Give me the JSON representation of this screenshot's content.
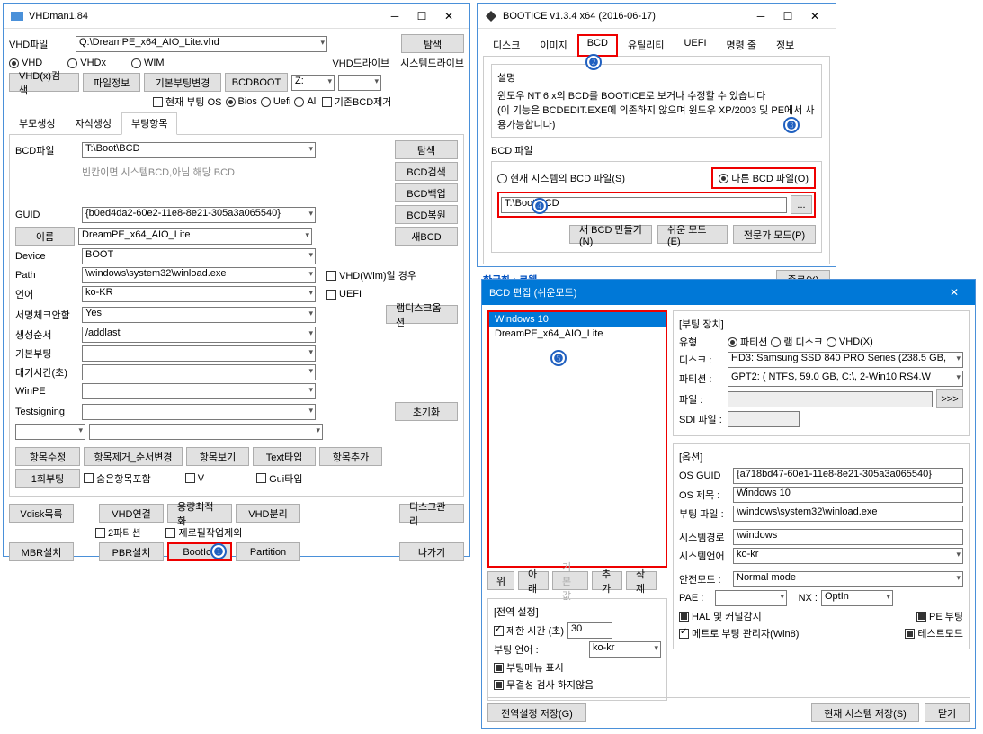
{
  "vhdman": {
    "title": "VHDman1.84",
    "vhdfile_label": "VHD파일",
    "vhdfile_value": "Q:\\DreamPE_x64_AIO_Lite.vhd",
    "browse": "탐색",
    "radio_vhd": "VHD",
    "radio_vhdx": "VHDx",
    "radio_wim": "WIM",
    "vhd_drive": "VHD드라이브",
    "sys_drive": "시스템드라이브",
    "btn_vhdx_search": "VHD(x)검색",
    "btn_fileinfo": "파일정보",
    "btn_basicboot": "기본부팅변경",
    "btn_bcdboot": "BCDBOOT",
    "drive_z": "Z:",
    "chk_current_boot": "현재 부팅 OS",
    "radio_bios": "Bios",
    "radio_uefi": "Uefi",
    "radio_all": "All",
    "chk_remove_bcd": "기존BCD제거",
    "tab_parent": "부모생성",
    "tab_child": "자식생성",
    "tab_boot": "부팅항목",
    "bcdfile_label": "BCD파일",
    "bcdfile_value": "T:\\Boot\\BCD",
    "bcdfile_hint": "빈칸이면 시스템BCD,아님 해당 BCD",
    "btn_search2": "탐색",
    "btn_bcd_search": "BCD검색",
    "btn_bcd_backup": "BCD백업",
    "btn_bcd_restore": "BCD복원",
    "btn_new_bcd": "새BCD",
    "guid_label": "GUID",
    "guid_value": "{b0ed4da2-60e2-11e8-8e21-305a3a065540}",
    "name_label": "이름",
    "name_value": "DreamPE_x64_AIO_Lite",
    "device_label": "Device",
    "device_value": "BOOT",
    "path_label": "Path",
    "path_value": "\\windows\\system32\\winload.exe",
    "lang_label": "언어",
    "lang_value": "ko-KR",
    "sign_label": "서명체크안함",
    "sign_value": "Yes",
    "order_label": "생성순서",
    "order_value": "/addlast",
    "default_boot": "기본부팅",
    "wait_time": "대기시간(초)",
    "winpe": "WinPE",
    "testsigning": "Testsigning",
    "chk_vhdwim": "VHD(Wim)일 경우",
    "chk_uefi": "UEFI",
    "btn_ramdisk": "램디스크옵션",
    "btn_init": "초기화",
    "btn_edit": "항목수정",
    "btn_remove": "항목제거_순서변경",
    "btn_view": "항목보기",
    "btn_texttype": "Text타입",
    "btn_add": "항목추가",
    "btn_oneboot": "1회부팅",
    "chk_hidden": "숨은항목포함",
    "chk_v": "V",
    "chk_guitype": "Gui타입",
    "btn_vdisk": "Vdisk목록",
    "btn_vhdconnect": "VHD연결",
    "btn_optimize": "용량최적화",
    "btn_vhdsplit": "VHD분리",
    "btn_diskmgr": "디스크관리",
    "chk_2part": "2파티션",
    "chk_zerofill": "제로필작업제외",
    "btn_mbr": "MBR설치",
    "btn_pbr": "PBR설치",
    "btn_bootice": "BootIce",
    "btn_partition": "Partition",
    "btn_exit": "나가기"
  },
  "bootice": {
    "title": "BOOTICE v1.3.4 x64 (2016-06-17)",
    "tabs": {
      "disk": "디스크",
      "image": "이미지",
      "bcd": "BCD",
      "util": "유틸리티",
      "uefi": "UEFI",
      "cmd": "명령 줄",
      "info": "정보"
    },
    "desc_label": "설명",
    "desc_text": "윈도우 NT 6.x의 BCD를 BOOTICE로 보거나 수정할 수 있습니다\n(이 기능은 BCDEDIT.EXE에 의존하지 않으며 윈도우 XP/2003 및 PE에서 사용가능합니다)",
    "bcdfile_label": "BCD 파일",
    "radio_current": "현재 시스템의 BCD 파일(S)",
    "radio_other": "다른 BCD 파일(O)",
    "bcd_path": "T:\\Boot\\BCD",
    "browse": "...",
    "btn_new": "새 BCD 만들기(N)",
    "btn_easy": "쉬운 모드(E)",
    "btn_expert": "전문가 모드(P)",
    "korean_label": "한글화 : 로웰",
    "btn_close": "종료(X)"
  },
  "bcdedit": {
    "title": "BCD 편집 (쉬운모드)",
    "entries": [
      "Windows 10",
      "DreamPE_x64_AIO_Lite"
    ],
    "btn_up": "위",
    "btn_down": "아래",
    "btn_default": "기본값",
    "btn_add": "추가",
    "btn_del": "삭제",
    "global_label": "[전역 설정]",
    "chk_timeout": "제한 시간 (초)",
    "timeout_value": "30",
    "boot_lang_label": "부팅 언어 :",
    "boot_lang_value": "ko-kr",
    "chk_bootmenu": "부팅메뉴 표시",
    "chk_integrity": "무결성 검사 하지않음",
    "btn_save_global": "전역설정 저장(G)",
    "bootdev_label": "[부팅 장치]",
    "type_label": "유형",
    "radio_partition": "파티션",
    "radio_ramdisk": "램 디스크",
    "radio_vhdx": "VHD(X)",
    "disk_label": "디스크 :",
    "disk_value": "HD3: Samsung SSD 840 PRO Series (238.5 GB,",
    "part_label": "파티션 :",
    "part_value": "GPT2: ( NTFS,  59.0 GB, C:\\, 2-Win10.RS4.W",
    "file_label": "파일 :",
    "browse_btn": ">>>",
    "sdi_label": "SDI 파일 :",
    "options_label": "[옵션]",
    "osguid_label": "OS GUID",
    "osguid_value": "{a718bd47-60e1-11e8-8e21-305a3a065540}",
    "ostitle_label": "OS 제목 :",
    "ostitle_value": "Windows 10",
    "bootfile_label": "부팅 파일 :",
    "bootfile_value": "\\windows\\system32\\winload.exe",
    "syspath_label": "시스템경로",
    "syspath_value": "\\windows",
    "syslang_label": "시스템언어",
    "syslang_value": "ko-kr",
    "safemode_label": "안전모드 :",
    "safemode_value": "Normal mode",
    "pae_label": "PAE :",
    "nx_label": "NX :",
    "nx_value": "OptIn",
    "chk_hal": "HAL 및 커널감지",
    "chk_peboot": "PE 부팅",
    "chk_metro": "메트로 부팅 관리자(Win8)",
    "chk_testmode": "테스트모드",
    "btn_save_current": "현재 시스템 저장(S)",
    "btn_close": "닫기"
  }
}
